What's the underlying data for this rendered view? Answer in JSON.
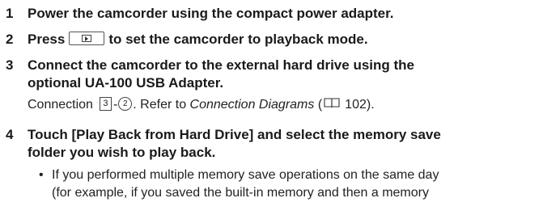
{
  "steps": [
    {
      "num": "1",
      "text": "Power the camcorder using the compact power adapter."
    },
    {
      "num": "2",
      "before": "Press",
      "after": "to set the camcorder to playback mode.",
      "key_icon": "playback-button-icon"
    },
    {
      "num": "3",
      "lines": [
        "Connect the camcorder to the external hard drive using the",
        "optional UA-100 USB Adapter."
      ],
      "note": {
        "prefix": "Connection",
        "box_num": "3",
        "dash": "-",
        "circle_num": "2",
        "mid": ". Refer to ",
        "ref_title": "Connection Diagrams",
        "paren_open": " (",
        "page_ref": "102",
        "paren_close": ")."
      }
    },
    {
      "num": "4",
      "lines": [
        "Touch [Play Back from Hard Drive] and select the memory save",
        "folder you wish to play back."
      ],
      "bullets": [
        {
          "lines": [
            "If you performed multiple memory save operations on the same day",
            "(for example, if you saved the built-in memory and then a memory"
          ]
        }
      ]
    }
  ],
  "icons": {
    "book": "manual-reference-icon"
  }
}
